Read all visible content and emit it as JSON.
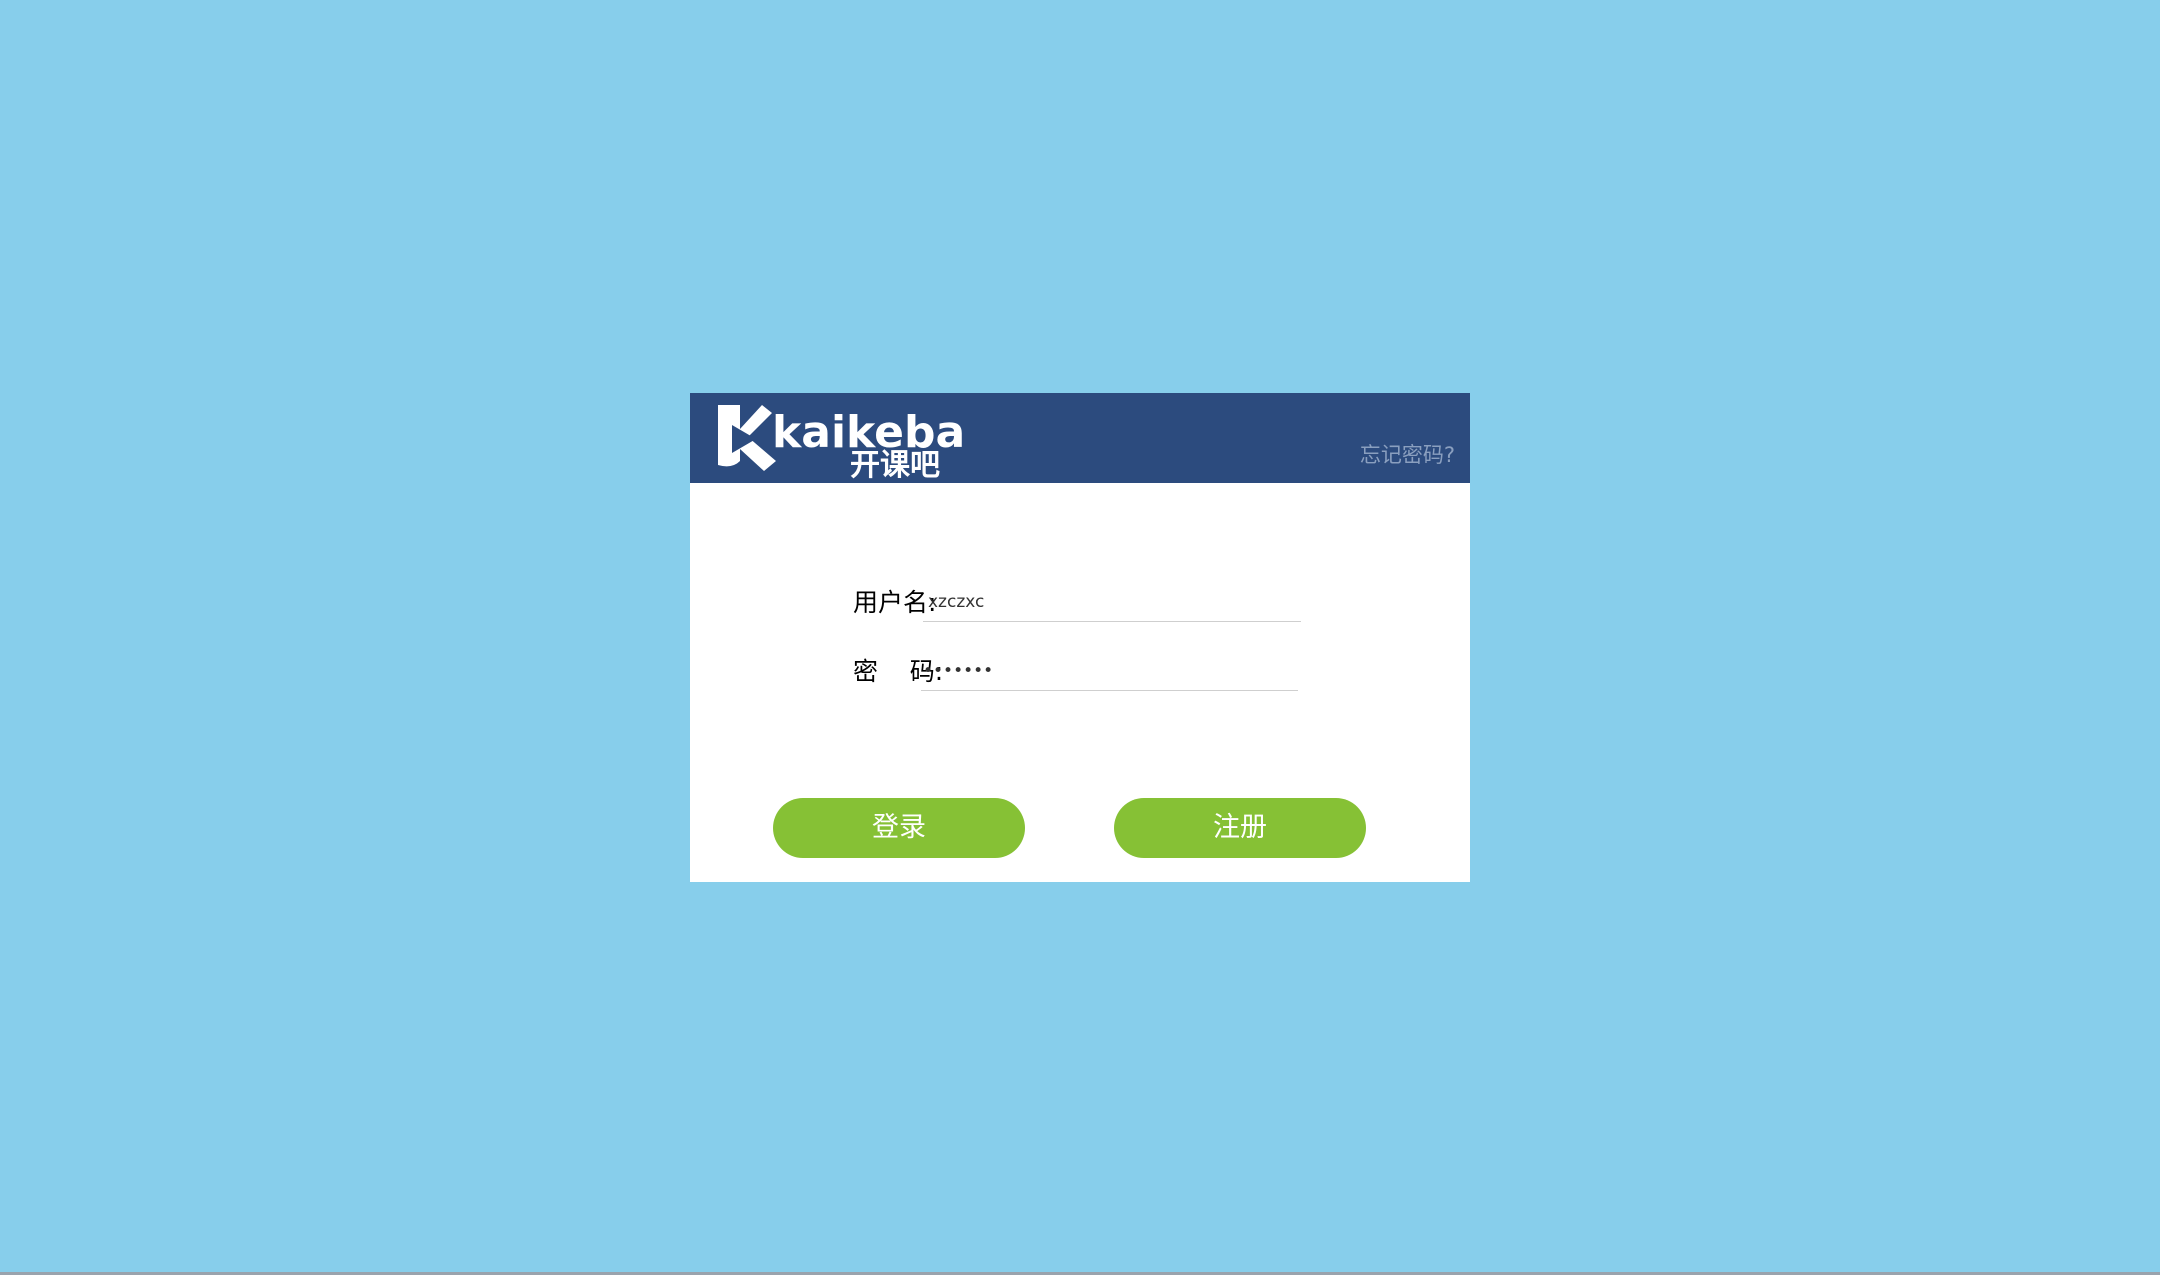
{
  "header": {
    "logo_text": "kaikeba",
    "logo_subtext": "开课吧",
    "forgot_password": "忘记密码?"
  },
  "form": {
    "username_label": "用户名:",
    "username_value": "xzczxc",
    "password_label": "密    码:",
    "password_value": "•••••••"
  },
  "buttons": {
    "login_label": "登录",
    "register_label": "注册"
  },
  "colors": {
    "page_background": "#87ceeb",
    "header_background": "#2c4b7e",
    "button_green": "#86c135",
    "forgot_link": "#8a9fbf"
  }
}
